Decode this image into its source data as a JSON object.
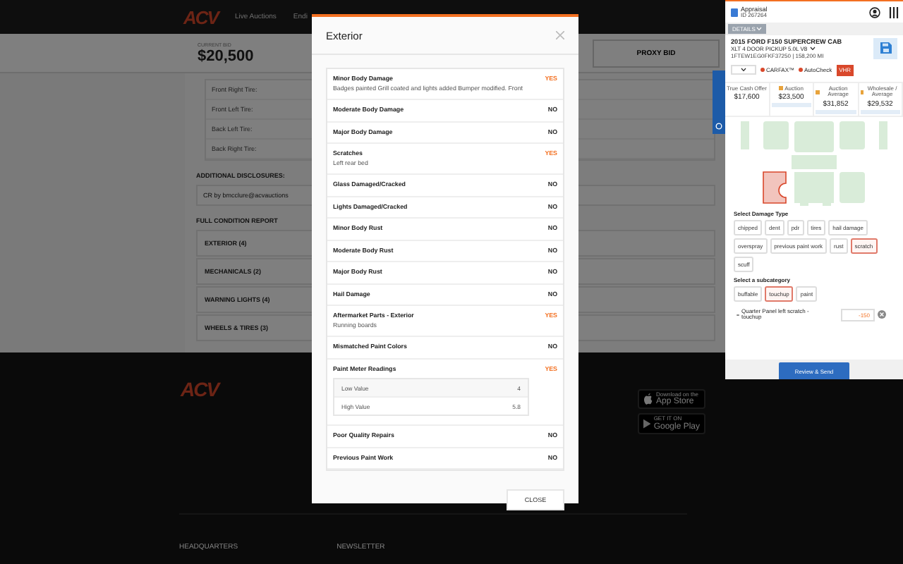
{
  "header": {
    "logo": "ACV",
    "nav": [
      "Live Auctions",
      "Endi"
    ]
  },
  "bid": {
    "label": "CURRENT BID",
    "amount": "$20,500",
    "proxy": "PROXY BID"
  },
  "tires": [
    "Front Right Tire:",
    "Front Left Tire:",
    "Back Left Tire:",
    "Back Right Tire:"
  ],
  "disclosures": {
    "title": "ADDITIONAL DISCLOSURES:",
    "text": "CR by bmcclure@acvauctions"
  },
  "report": {
    "title": "FULL CONDITION REPORT",
    "sections": [
      "EXTERIOR (4)",
      "MECHANICALS (2)",
      "WARNING LIGHTS (4)",
      "WHEELS & TIRES (3)"
    ]
  },
  "footer": {
    "logo": "ACV",
    "app_store": {
      "small": "Download on the",
      "big": "App Store"
    },
    "google_play": {
      "small": "GET IT ON",
      "big": "Google Play"
    },
    "headings": [
      "HEADQUARTERS",
      "NEWSLETTER"
    ]
  },
  "modal": {
    "title": "Exterior",
    "close": "CLOSE",
    "items": [
      {
        "label": "Minor Body Damage",
        "note": "Badges painted Grill coated and lights added Bumper modified. Front",
        "answer": "YES",
        "flagged": true
      },
      {
        "label": "Moderate Body Damage",
        "answer": "NO",
        "flagged": false
      },
      {
        "label": "Major Body Damage",
        "answer": "NO",
        "flagged": false
      },
      {
        "label": "Scratches",
        "note": "Left rear bed",
        "answer": "YES",
        "flagged": true
      },
      {
        "label": "Glass Damaged/Cracked",
        "answer": "NO",
        "flagged": false
      },
      {
        "label": "Lights Damaged/Cracked",
        "answer": "NO",
        "flagged": false
      },
      {
        "label": "Minor Body Rust",
        "answer": "NO",
        "flagged": false
      },
      {
        "label": "Moderate Body Rust",
        "answer": "NO",
        "flagged": false
      },
      {
        "label": "Major Body Rust",
        "answer": "NO",
        "flagged": false
      },
      {
        "label": "Hail Damage",
        "answer": "NO",
        "flagged": false
      },
      {
        "label": "Aftermarket Parts - Exterior",
        "note": "Running boards",
        "answer": "YES",
        "flagged": true
      },
      {
        "label": "Mismatched Paint Colors",
        "answer": "NO",
        "flagged": false
      },
      {
        "label": "Paint Meter Readings",
        "answer": "YES",
        "flagged": true,
        "readings": [
          {
            "label": "Low Value",
            "value": "4"
          },
          {
            "label": "High Value",
            "value": "5.8"
          }
        ]
      },
      {
        "label": "Poor Quality Repairs",
        "answer": "NO",
        "flagged": false
      },
      {
        "label": "Previous Paint Work",
        "answer": "NO",
        "flagged": false
      }
    ]
  },
  "panel": {
    "title": "Appraisal",
    "id": "ID 267264",
    "details_tab": "DETAILS",
    "vehicle": {
      "name": "2015 FORD F150 SUPERCREW CAB",
      "trim": "XLT 4 DOOR PICKUP 5.0L V8",
      "vin": "1FTEW1EG0FKF37250 | 158,200 MI"
    },
    "reports": [
      "CARFAX™",
      "AutoCheck"
    ],
    "vhr": "VHR",
    "values": [
      {
        "label": "True Cash Offer",
        "value": "$17,600",
        "kind": "plain"
      },
      {
        "label": "Auction",
        "value": "$23,500",
        "kind": "source"
      },
      {
        "label": "Auction Average",
        "value": "$31,852",
        "kind": "source"
      },
      {
        "label": "Wholesale / Average",
        "value": "$29,532",
        "kind": "source"
      }
    ],
    "damage_types": {
      "title": "Select Damage Type",
      "options": [
        {
          "label": "chipped",
          "selected": false
        },
        {
          "label": "dent",
          "selected": false
        },
        {
          "label": "pdr",
          "selected": false
        },
        {
          "label": "tires",
          "selected": false
        },
        {
          "label": "hail damage",
          "selected": false
        },
        {
          "label": "overspray",
          "selected": false
        },
        {
          "label": "previous paint work",
          "selected": false
        },
        {
          "label": "rust",
          "selected": false
        },
        {
          "label": "scratch",
          "selected": true
        },
        {
          "label": "scuff",
          "selected": false
        }
      ]
    },
    "subcategories": {
      "title": "Select a subcategory",
      "options": [
        {
          "label": "buffable",
          "selected": false
        },
        {
          "label": "touchup",
          "selected": true
        },
        {
          "label": "paint",
          "selected": false
        }
      ]
    },
    "entry": {
      "text": "Quarter Panel left scratch - touchup",
      "value": "-150"
    },
    "submit": "Review & Send"
  }
}
